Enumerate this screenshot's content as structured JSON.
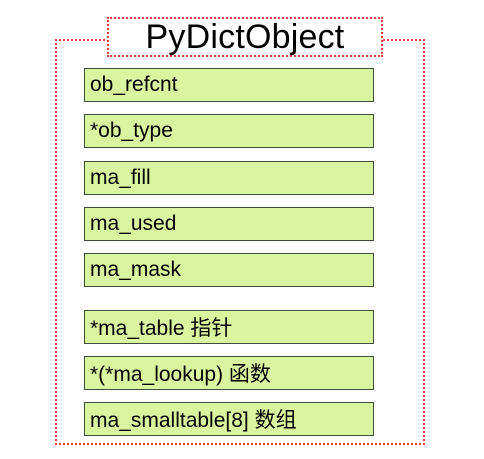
{
  "title": "PyDictObject",
  "fields": [
    "ob_refcnt",
    "*ob_type",
    "ma_fill",
    "ma_used",
    "ma_mask",
    "*ma_table 指针",
    "*(*ma_lookup) 函数",
    "ma_smalltable[8]  数组"
  ],
  "colors": {
    "field_fill": "#d9f5a0",
    "field_border": "#3f4b3c",
    "dotted_border": "#e0413f"
  }
}
